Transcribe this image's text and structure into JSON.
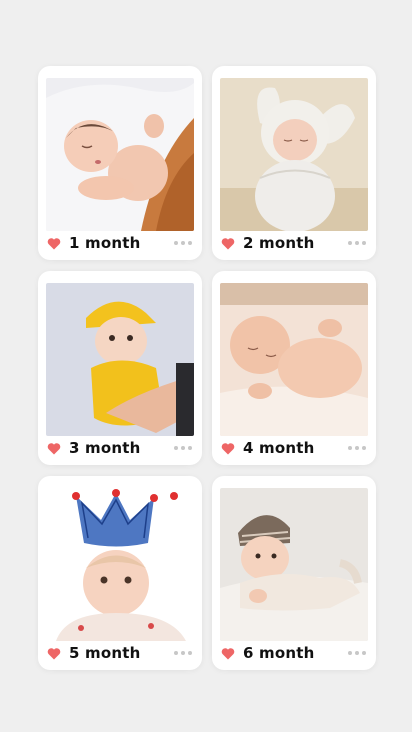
{
  "cards": [
    {
      "label": "1 month",
      "icon": "heart-icon",
      "menu_icon": "more-dots-icon"
    },
    {
      "label": "2 month",
      "icon": "heart-icon",
      "menu_icon": "more-dots-icon"
    },
    {
      "label": "3 month",
      "icon": "heart-icon",
      "menu_icon": "more-dots-icon"
    },
    {
      "label": "4 month",
      "icon": "heart-icon",
      "menu_icon": "more-dots-icon"
    },
    {
      "label": "5 month",
      "icon": "heart-icon",
      "menu_icon": "more-dots-icon"
    },
    {
      "label": "6 month",
      "icon": "heart-icon",
      "menu_icon": "more-dots-icon"
    }
  ],
  "colors": {
    "background": "#efefef",
    "card": "#ffffff",
    "heart": "#ee6666",
    "dots": "#c7c7c7",
    "label": "#111111"
  }
}
